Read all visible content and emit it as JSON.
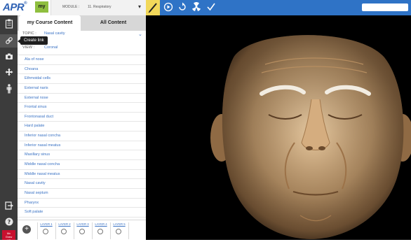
{
  "app": {
    "logo": "APR",
    "logo_mark": "®",
    "my_tab": "my"
  },
  "module": {
    "label": "MODULE :",
    "value": "11. Respiratory"
  },
  "search": {
    "value": "",
    "placeholder": ""
  },
  "tabs": {
    "my_course_content": "my Course Content",
    "all_content": "All Content"
  },
  "topic": {
    "label": "TOPIC :",
    "value": "Nasal cavity"
  },
  "view": {
    "label": "VIEW :",
    "value": "Coronal"
  },
  "tooltip": "Create link",
  "structures": [
    "Ala of nose",
    "Choana",
    "Ethmoidal cells",
    "External naris",
    "External nose",
    "Frontal sinus",
    "Frontonasal duct",
    "Hard palate",
    "Inferior nasal concha",
    "Inferior nasal meatus",
    "Maxillary sinus",
    "Middle nasal concha",
    "Middle nasal meatus",
    "Nasal cavity",
    "Nasal septum",
    "Pharynx",
    "Soft palate"
  ],
  "layers": [
    "LAYER 1",
    "LAYER 2",
    "LAYER 3",
    "LAYER 4",
    "LAYER 5"
  ],
  "publisher": {
    "line1": "Mc",
    "line2": "Graw",
    "line3": "Hill"
  },
  "colors": {
    "toolbar_blue": "#2f73c6",
    "my_tab_green": "#8fbf3f",
    "pen_yellow": "#f2d85a",
    "link_blue": "#3b73c4",
    "rail_dark": "#3c3c3c"
  },
  "icons": {
    "toolbar": [
      "pen-icon",
      "play-icon",
      "rotate-icon",
      "radiation-icon",
      "checkmark-icon"
    ],
    "rail": [
      "clipboard-icon",
      "link-icon",
      "camera-icon",
      "move-icon",
      "person-icon",
      "exit-icon",
      "help-icon"
    ]
  }
}
